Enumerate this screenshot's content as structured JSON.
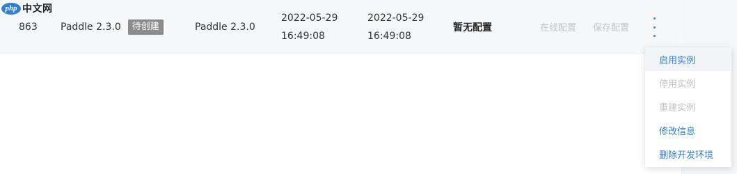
{
  "watermark": {
    "logo_text": "php",
    "site_text": "中文网"
  },
  "row": {
    "id": "863",
    "name": "Paddle 2.3.0",
    "status_badge": "待创建",
    "runtime": "Paddle 2.3.0",
    "created_date": "2022-05-29",
    "created_time": "16:49:08",
    "updated_date": "2022-05-29",
    "updated_time": "16:49:08",
    "config_status": "暂无配置",
    "online_config_label": "在线配置",
    "save_config_label": "保存配置",
    "more_icon": "kebab-vertical-icon"
  },
  "menu": {
    "items": [
      {
        "label": "启用实例",
        "state": "hover"
      },
      {
        "label": "停用实例",
        "state": "disabled"
      },
      {
        "label": "重建实例",
        "state": "disabled"
      },
      {
        "label": "修改信息",
        "state": "enabled"
      },
      {
        "label": "删除开发环境",
        "state": "enabled"
      }
    ]
  },
  "colors": {
    "accent": "#2f7fd8",
    "disabled_text": "#c3c3c3",
    "badge_bg": "#8c8c8c",
    "row_bg": "#f6f7f9"
  }
}
